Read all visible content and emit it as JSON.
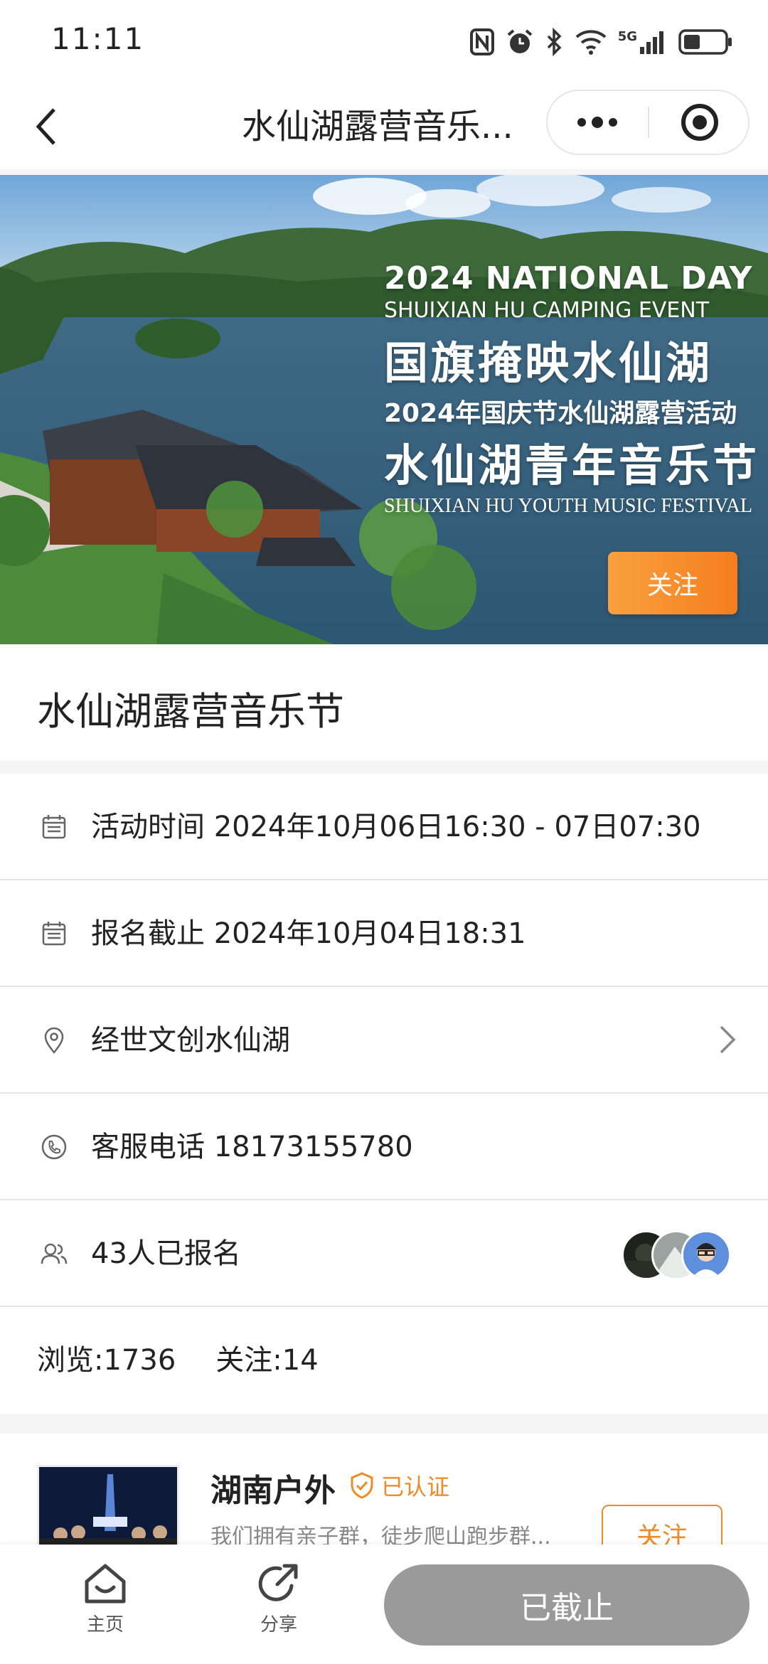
{
  "status_bar": {
    "time": "11:11",
    "network": "5G"
  },
  "nav": {
    "title": "水仙湖露营音乐...",
    "icons": {
      "back": "chevron-left-icon",
      "more": "more-dots-icon",
      "close": "target-close-icon"
    }
  },
  "banner": {
    "line1": "2024 NATIONAL DAY",
    "line2": "SHUIXIAN HU CAMPING EVENT",
    "line3": "国旗掩映水仙湖",
    "line4": "2024年国庆节水仙湖露营活动",
    "line5": "水仙湖青年音乐节",
    "line6": "SHUIXIAN HU YOUTH MUSIC FESTIVAL",
    "follow_label": "关注"
  },
  "event": {
    "title": "水仙湖露营音乐节"
  },
  "info": {
    "activity_time": "活动时间 2024年10月06日16:30 - 07日07:30",
    "deadline": "报名截止 2024年10月04日18:31",
    "location": "经世文创水仙湖",
    "phone": "客服电话 18173155780",
    "registered": "43人已报名"
  },
  "stats": {
    "views": "浏览:1736",
    "follows": "关注:14"
  },
  "organizer": {
    "name": "湖南户外",
    "verified_label": "已认证",
    "description": "我们拥有亲子群，徒步爬山跑步群...",
    "follow_label": "关注"
  },
  "bottom": {
    "home_label": "主页",
    "share_label": "分享",
    "action_label": "已截止"
  },
  "colors": {
    "accent": "#f08a24",
    "disabled": "#9a9a9a"
  }
}
